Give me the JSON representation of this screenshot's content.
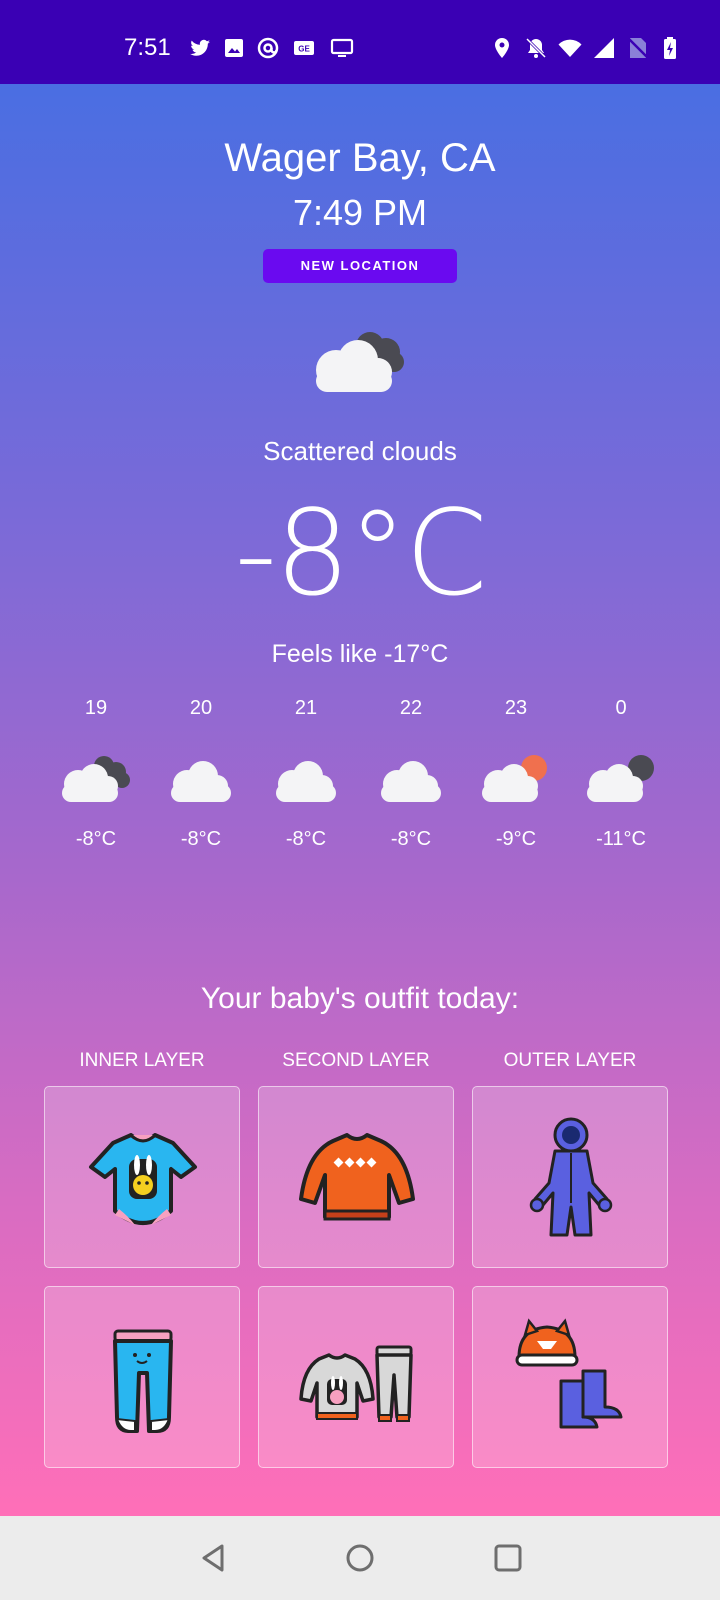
{
  "status_bar": {
    "time": "7:51",
    "left_icons": [
      "twitter-icon",
      "image-icon",
      "at-sign-icon",
      "news-icon",
      "cast-icon"
    ],
    "right_icons": [
      "location-icon",
      "bell-off-icon",
      "wifi-icon",
      "signal-icon",
      "no-sim-icon",
      "battery-charging-icon"
    ],
    "background": "#3a00b4"
  },
  "header": {
    "location": "Wager Bay, CA",
    "time": "7:49 PM",
    "new_location_label": "NEW LOCATION"
  },
  "current": {
    "icon": "cloudy-night-icon",
    "condition": "Scattered clouds",
    "temperature": "-8°C",
    "feels_like": "Feels like -17°C"
  },
  "forecast": [
    {
      "hour": "19",
      "icon": "cloudy-night-icon",
      "temp": "-8°C"
    },
    {
      "hour": "20",
      "icon": "cloud-icon",
      "temp": "-8°C"
    },
    {
      "hour": "21",
      "icon": "cloud-icon",
      "temp": "-8°C"
    },
    {
      "hour": "22",
      "icon": "cloud-icon",
      "temp": "-8°C"
    },
    {
      "hour": "23",
      "icon": "cloudy-sun-icon",
      "temp": "-9°C"
    },
    {
      "hour": "0",
      "icon": "cloudy-night-icon",
      "temp": "-11°C"
    }
  ],
  "outfit": {
    "title": "Your baby's outfit today:",
    "columns": [
      "INNER LAYER",
      "SECOND LAYER",
      "OUTER LAYER"
    ],
    "items": [
      "bodysuit-icon",
      "sweater-icon",
      "snowsuit-icon",
      "footed-pants-icon",
      "sweater-and-pants-icon",
      "hat-and-boots-icon"
    ]
  },
  "nav": {
    "icons": [
      "back-icon",
      "home-icon",
      "recents-icon"
    ]
  },
  "colors": {
    "accent_button": "#6a0af0",
    "gradient_top": "#4a6ee2",
    "gradient_bottom": "#ff6fb8"
  }
}
